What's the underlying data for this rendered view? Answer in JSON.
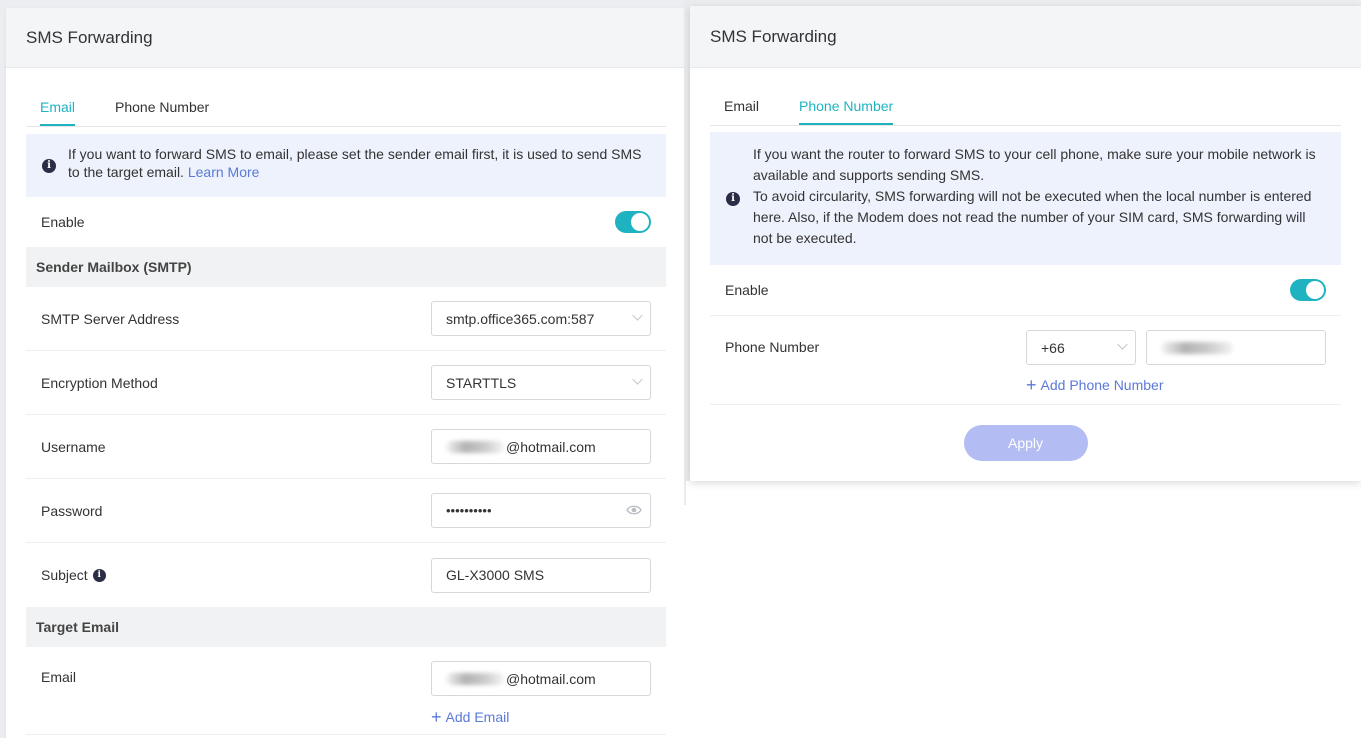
{
  "left": {
    "title": "SMS Forwarding",
    "tabs": [
      {
        "label": "Email"
      },
      {
        "label": "Phone Number"
      }
    ],
    "notice": {
      "text": "If you want to forward SMS to email, please set the sender email first, it is used to send SMS to the target email. ",
      "link": "Learn More"
    },
    "enable_label": "Enable",
    "enabled": true,
    "sender_section": "Sender Mailbox (SMTP)",
    "smtp_label": "SMTP Server Address",
    "smtp_value": "smtp.office365.com:587",
    "encryption_label": "Encryption Method",
    "encryption_value": "STARTTLS",
    "username_label": "Username",
    "username_value": "@hotmail.com",
    "password_label": "Password",
    "password_value": "••••••••••",
    "subject_label": "Subject",
    "subject_value": "GL-X3000 SMS",
    "target_section": "Target Email",
    "email_label": "Email",
    "email_value": "@hotmail.com",
    "add_email": "Add Email"
  },
  "right": {
    "title": "SMS Forwarding",
    "tabs": [
      {
        "label": "Email"
      },
      {
        "label": "Phone Number"
      }
    ],
    "notice": {
      "line1": "If you want the router to forward SMS to your cell phone, make sure your mobile network is available and supports sending SMS.",
      "line2": "To avoid circularity, SMS forwarding will not be executed when the local number is entered here. Also, if the Modem does not read the number of your SIM card, SMS forwarding will not be executed."
    },
    "enable_label": "Enable",
    "enabled": true,
    "phone_label": "Phone Number",
    "country_code": "+66",
    "add_phone": "Add Phone Number",
    "apply_label": "Apply"
  },
  "colors": {
    "accent": "#1fb3c2",
    "link": "#5a79d8",
    "apply_disabled": "#b3bcf3",
    "notice_bg": "#eef2fc"
  }
}
